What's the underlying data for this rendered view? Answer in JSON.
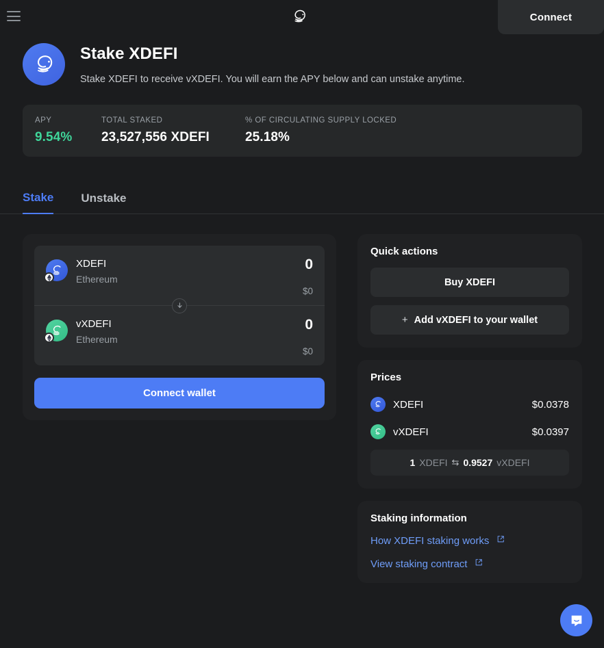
{
  "topbar": {
    "menu_icon": "hamburger-menu-icon",
    "logo_icon": "xdefi-logo-icon",
    "connect_label": "Connect"
  },
  "header": {
    "avatar_icon": "xdefi-token-logo",
    "title": "Stake XDEFI",
    "subtitle": "Stake XDEFI to receive vXDEFI. You will earn the APY below and can unstake anytime."
  },
  "stats": [
    {
      "label": "APY",
      "value": "9.54%",
      "accent": true
    },
    {
      "label": "TOTAL STAKED",
      "value": "23,527,556 XDEFI",
      "accent": false
    },
    {
      "label": "% OF CIRCULATING SUPPLY LOCKED",
      "value": "25.18%",
      "accent": false
    }
  ],
  "tabs": [
    {
      "label": "Stake",
      "active": true
    },
    {
      "label": "Unstake",
      "active": false
    }
  ],
  "stake_card": {
    "from": {
      "symbol": "XDEFI",
      "chain": "Ethereum",
      "amount": "0",
      "fiat": "$0",
      "icon": "xdefi-token-icon",
      "chain_icon": "ethereum-badge-icon"
    },
    "to": {
      "symbol": "vXDEFI",
      "chain": "Ethereum",
      "amount": "0",
      "fiat": "$0",
      "icon": "vxdefi-token-icon",
      "chain_icon": "ethereum-badge-icon"
    },
    "swap_icon": "arrow-down-icon",
    "cta_label": "Connect wallet"
  },
  "quick_actions": {
    "title": "Quick actions",
    "buy_label": "Buy XDEFI",
    "add_label": "Add vXDEFI to your wallet",
    "plus_icon": "plus-icon"
  },
  "prices": {
    "title": "Prices",
    "rows": [
      {
        "symbol": "XDEFI",
        "price": "$0.0378",
        "icon": "xdefi-token-icon"
      },
      {
        "symbol": "vXDEFI",
        "price": "$0.0397",
        "icon": "vxdefi-token-icon"
      }
    ],
    "rate": {
      "left_amount": "1",
      "left_symbol": "XDEFI",
      "swap_icon": "swap-arrows-icon",
      "right_amount": "0.9527",
      "right_symbol": "vXDEFI"
    }
  },
  "staking_info": {
    "title": "Staking information",
    "links": [
      {
        "label": "How XDEFI staking works",
        "icon": "external-link-icon"
      },
      {
        "label": "View staking contract",
        "icon": "external-link-icon"
      }
    ]
  },
  "chat": {
    "icon": "intercom-chat-icon"
  },
  "colors": {
    "background": "#1b1c1e",
    "panel": "#202123",
    "panel_light": "#2b2d2f",
    "accent_blue": "#4d7cf5",
    "accent_green": "#3fd69a",
    "link_blue": "#6f9df8",
    "muted_text": "#9aa0a6"
  }
}
